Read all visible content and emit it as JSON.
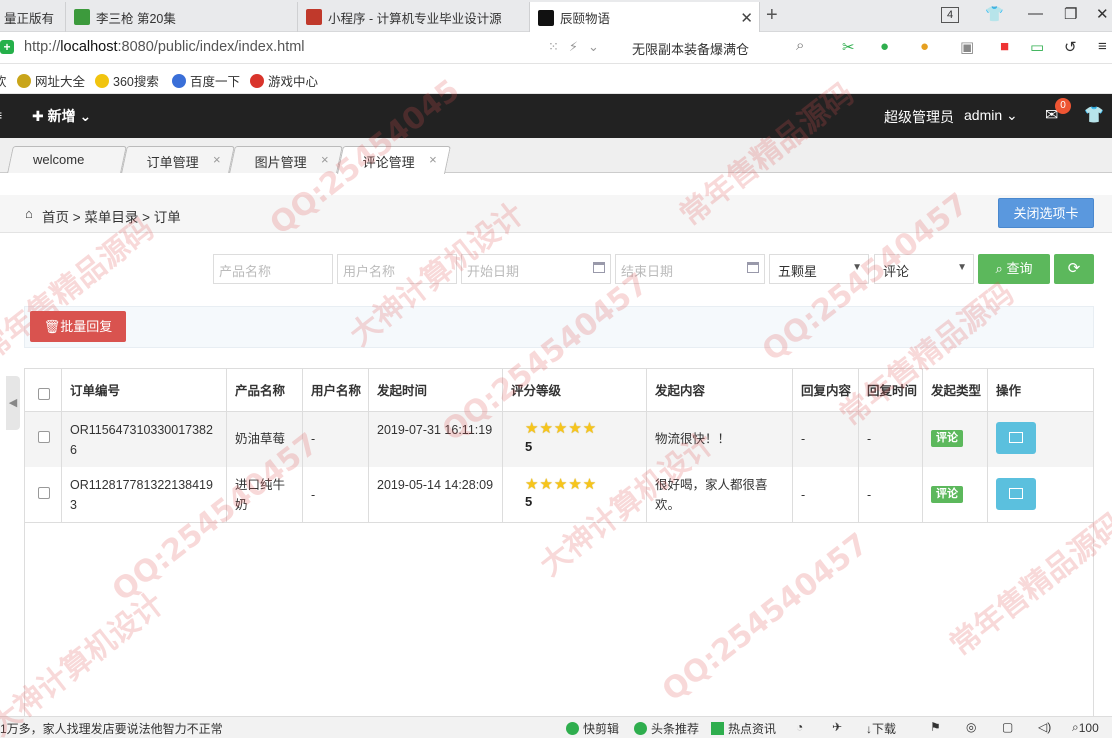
{
  "browser": {
    "tabs": [
      {
        "label": "量正版有",
        "icon_color": "#e7e7e7"
      },
      {
        "label": "李三枪 第20集",
        "icon_color": "#3c9a3c"
      },
      {
        "label": "小程序 - 计算机专业毕业设计源",
        "icon_color": "#c0392b"
      },
      {
        "label": "辰颐物语",
        "icon_color": "#111111"
      }
    ],
    "tab_count": "4",
    "url_prefix": "http://",
    "url_host": "localhost",
    "url_rest": ":8080/public/index/index.html",
    "hot_search": "无限副本装备爆满仓",
    "bookmarks": [
      "欢",
      "网址大全",
      "360搜索",
      "百度一下",
      "游戏中心"
    ]
  },
  "header": {
    "lead": "≡",
    "add_label": "新增",
    "role": "超级管理员",
    "user": "admin",
    "mail_count": "0"
  },
  "app_tabs": [
    "welcome",
    "订单管理",
    "图片管理",
    "评论管理"
  ],
  "breadcrumb": {
    "home": "首页",
    "path": "菜单目录  >  订单",
    "close_tabs": "关闭选项卡"
  },
  "filters": {
    "product_placeholder": "产品名称",
    "user_placeholder": "用户名称",
    "start_placeholder": "开始日期",
    "end_placeholder": "结束日期",
    "rating": "五颗星",
    "type": "评论",
    "query_label": "查询",
    "refresh_label": "⟳"
  },
  "batch_label": "批量回复",
  "table": {
    "headers": [
      "订单编号",
      "产品名称",
      "用户名称",
      "发起时间",
      "评分等级",
      "发起内容",
      "回复内容",
      "回复时间",
      "发起类型",
      "操作"
    ],
    "rows": [
      {
        "order_no": "OR1156473103300173826",
        "product": "奶油草莓",
        "user": "-",
        "time": "2019-07-31 16:11:19",
        "stars": "★★★★★",
        "score": "5",
        "content": "物流很快！！",
        "reply": "-",
        "reply_time": "-",
        "type": "评论"
      },
      {
        "order_no": "OR1128177813221384193",
        "product": "进口纯牛奶",
        "user": "-",
        "time": "2019-05-14 14:28:09",
        "stars": "★★★★★",
        "score": "5",
        "content": "很好喝，家人都很喜欢。",
        "reply": "-",
        "reply_time": "-",
        "type": "评论"
      }
    ]
  },
  "statusbar": {
    "news": "1万多，家人找理发店要说法他智力不正常",
    "items": [
      "快剪辑",
      "头条推荐",
      "热点资讯",
      "下载",
      "100"
    ]
  },
  "watermarks": [
    "常年售精品源码",
    "QQ:25454045",
    "大神计算机设计",
    "QQ:254540457",
    "常年售精品源码",
    "QQ:254540457",
    "大神计算机设计",
    "常年售精品源码",
    "QQ:254540457",
    "大神计算机设计",
    "QQ:254540457",
    "常年售精品源码"
  ]
}
